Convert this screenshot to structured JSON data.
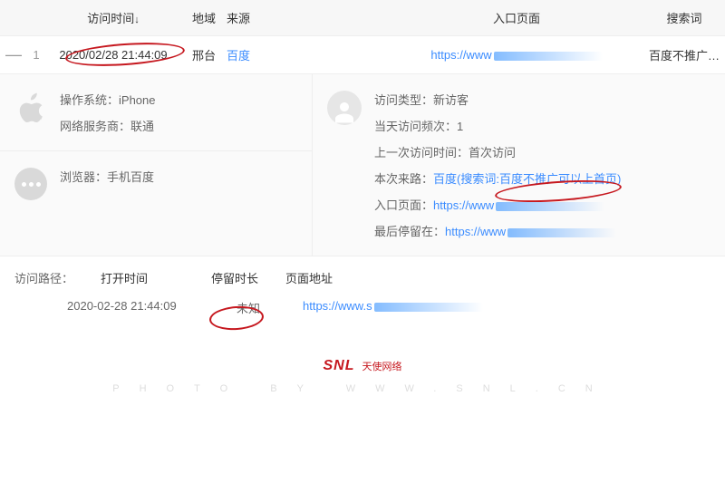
{
  "header": {
    "time": "访问时间",
    "sortArrow": "↓",
    "region": "地域",
    "source": "来源",
    "entry": "入口页面",
    "search": "搜索词"
  },
  "row": {
    "expand": "—",
    "num": "1",
    "time": "2020/02/28 21:44:09",
    "region": "邢台",
    "source": "百度",
    "entryPrefix": "https://www",
    "search": "百度不推广…"
  },
  "detailLeft": {
    "osLabel": "操作系统：",
    "osValue": "iPhone",
    "ispLabel": "网络服务商：",
    "ispValue": "联通",
    "browserLabel": "浏览器：",
    "browserValue": "手机百度"
  },
  "detailRight": {
    "typeLabel": "访问类型：",
    "typeValue": "新访客",
    "freqLabel": "当天访问频次：",
    "freqValue": "1",
    "lastLabel": "上一次访问时间：",
    "lastValue": "首次访问",
    "pathLabel": "本次来路：",
    "pathValue": "百度(搜索词:百度不推广可以上首页)",
    "entryLabel": "入口页面：",
    "entryValue": "https://www",
    "stayLabel": "最后停留在：",
    "stayValue": "https://www"
  },
  "path": {
    "sectionLabel": "访问路径：",
    "openLabel": "打开时间",
    "durLabel": "停留时长",
    "urlLabel": "页面地址",
    "time": "2020-02-28 21:44:09",
    "dur": "未知",
    "url": "https://www.s"
  },
  "footer": {
    "snl": "SNL",
    "cn": "天使网络",
    "letters": "PHOTO BY WWW.SNL.CN"
  }
}
